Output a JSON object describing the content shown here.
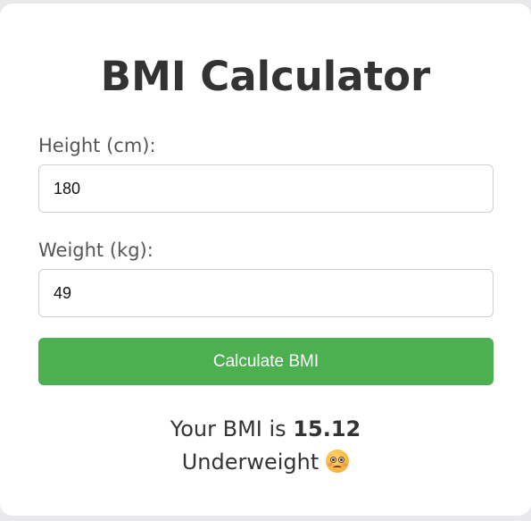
{
  "app": {
    "title": "BMI Calculator"
  },
  "form": {
    "height_label": "Height (cm):",
    "height_value": "180",
    "weight_label": "Weight (kg):",
    "weight_value": "49",
    "submit_label": "Calculate BMI"
  },
  "result": {
    "prefix": "Your BMI is ",
    "bmi": "15.12",
    "category": "Underweight",
    "category_icon": "flushed-face-icon"
  },
  "colors": {
    "button": "#4caf50",
    "title": "#333333",
    "label": "#555555"
  }
}
